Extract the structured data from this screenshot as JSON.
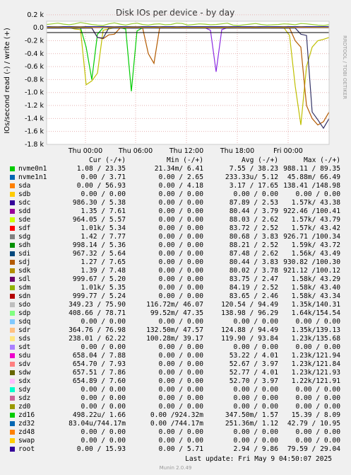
{
  "chart_data": {
    "type": "line",
    "title": "Disk IOs per device - by day",
    "ylabel": "IOs/second read (-) / write (+)",
    "ylim": [
      -1800,
      100
    ],
    "y_ticks": [
      "0.2 k",
      "0.0",
      "-0.2 k",
      "-0.4 k",
      "-0.6 k",
      "-0.8 k",
      "-1.0 k",
      "-1.2 k",
      "-1.4 k",
      "-1.6 k",
      "-1.8 k"
    ],
    "x_ticks": [
      "Thu 00:00",
      "Thu 06:00",
      "Thu 12:00",
      "Thu 18:00",
      "Fri 00:00"
    ],
    "grid": true,
    "series_read": [
      {
        "name": "sdm",
        "color": "#bfbf00",
        "values": [
          0,
          0,
          0,
          0,
          0,
          -20,
          -30,
          -880,
          -820,
          -700,
          -40,
          -20,
          0,
          0,
          0,
          0,
          0,
          0,
          0,
          0,
          0,
          0,
          0,
          0,
          0,
          0,
          0,
          0,
          0,
          0,
          0,
          0,
          0,
          0,
          0,
          0,
          0,
          0,
          0,
          0,
          0,
          0,
          0,
          -120,
          -900,
          -1500,
          -600,
          -300,
          -200,
          -180,
          -150
        ]
      },
      {
        "name": "zd16",
        "color": "#00cc00",
        "values": [
          0,
          0,
          0,
          0,
          0,
          0,
          0,
          -300,
          -800,
          -100,
          0,
          0,
          0,
          0,
          -20,
          -980,
          -50,
          0,
          0,
          0,
          0,
          0,
          0,
          0,
          0,
          0,
          0,
          0,
          0,
          0,
          0,
          0,
          0,
          0,
          0,
          0,
          0,
          0,
          0,
          0,
          0,
          0,
          0,
          0,
          0,
          0,
          0,
          0,
          0,
          0,
          0
        ]
      },
      {
        "name": "sdc",
        "color": "#8a2be2",
        "values": [
          0,
          0,
          0,
          0,
          0,
          0,
          0,
          0,
          0,
          0,
          0,
          0,
          0,
          0,
          0,
          0,
          0,
          0,
          0,
          0,
          0,
          0,
          0,
          0,
          0,
          0,
          0,
          0,
          0,
          -40,
          -680,
          -30,
          0,
          0,
          0,
          0,
          0,
          0,
          0,
          0,
          0,
          0,
          0,
          0,
          0,
          0,
          0,
          0,
          0,
          0,
          0
        ]
      },
      {
        "name": "sdj",
        "color": "#b35a00",
        "values": [
          -5,
          -5,
          -5,
          -5,
          -5,
          -5,
          -5,
          -5,
          -5,
          -150,
          -170,
          -110,
          -100,
          -5,
          -5,
          -5,
          -5,
          -5,
          -400,
          -550,
          -5,
          -5,
          -5,
          -5,
          -5,
          -5,
          -5,
          -5,
          -5,
          -5,
          -5,
          -5,
          -5,
          -5,
          -5,
          -5,
          -5,
          -5,
          -5,
          -5,
          -5,
          -5,
          -5,
          -5,
          -200,
          -300,
          -1200,
          -1400,
          -1500,
          -1450,
          -1300
        ]
      },
      {
        "name": "sdi",
        "color": "#333366",
        "values": [
          -5,
          -5,
          -5,
          -5,
          -5,
          -5,
          -5,
          -5,
          -5,
          -150,
          -160,
          -5,
          -5,
          -5,
          -5,
          -5,
          -5,
          -5,
          -5,
          -5,
          -5,
          -5,
          -5,
          -5,
          -5,
          -5,
          -5,
          -5,
          -5,
          -5,
          -5,
          -5,
          -5,
          -5,
          -5,
          -5,
          -5,
          -5,
          -5,
          -5,
          -5,
          -5,
          -5,
          -5,
          -5,
          -100,
          -120,
          -1300,
          -1420,
          -1550,
          -1400
        ]
      }
    ],
    "series_write": [
      {
        "name": "sdl",
        "color": "#9acd32",
        "values": [
          50,
          60,
          70,
          55,
          45,
          60,
          80,
          65,
          50,
          40,
          35,
          60,
          75,
          55,
          40,
          60,
          70,
          50,
          40,
          55,
          60,
          45,
          50,
          70,
          65,
          40,
          50,
          60,
          55,
          45,
          50,
          60,
          70,
          40,
          35,
          45,
          55,
          65,
          50,
          40,
          45,
          50,
          60,
          55,
          45,
          65,
          60,
          50,
          40,
          35,
          45
        ]
      },
      {
        "name": "root",
        "color": "#000099",
        "values": [
          16,
          16,
          16,
          16,
          16,
          16,
          16,
          16,
          16,
          16,
          16,
          16,
          16,
          16,
          16,
          16,
          16,
          16,
          16,
          16,
          16,
          16,
          16,
          16,
          16,
          16,
          16,
          16,
          16,
          16,
          16,
          16,
          16,
          16,
          16,
          16,
          16,
          16,
          16,
          16,
          16,
          16,
          16,
          16,
          16,
          16,
          16,
          16,
          16,
          16,
          16
        ]
      },
      {
        "name": "zd48",
        "color": "#cc9900",
        "values": [
          5,
          8,
          10,
          6,
          5,
          8,
          12,
          6,
          5,
          4,
          4,
          6,
          10,
          6,
          5,
          8,
          10,
          6,
          5,
          6,
          8,
          5,
          5,
          8,
          6,
          5,
          5,
          6,
          6,
          5,
          5,
          6,
          8,
          5,
          4,
          5,
          6,
          8,
          5,
          4,
          5,
          6,
          8,
          6,
          5,
          8,
          6,
          5,
          4,
          4,
          5
        ]
      }
    ]
  },
  "legend": {
    "headers": {
      "cur": "Cur (-/+)",
      "min": "Min (-/+)",
      "avg": "Avg (-/+)",
      "max": "Max (-/+)"
    },
    "rows": [
      {
        "name": "nvme0n1",
        "color": "#00cc00",
        "cur": "1.08 / 23.35",
        "min": "21.34m/ 6.41",
        "avg": "7.55 / 38.23",
        "max": "988.11 / 89.35"
      },
      {
        "name": "nvme1n1",
        "color": "#0066b3",
        "cur": "0.00 / 3.71",
        "min": "0.00 / 2.65",
        "avg": "233.33u/ 5.12",
        "max": "45.88m/ 66.49"
      },
      {
        "name": "sda",
        "color": "#ff8000",
        "cur": "0.00 / 56.93",
        "min": "0.00 / 4.18",
        "avg": "3.17 / 17.65",
        "max": "138.41 /148.98"
      },
      {
        "name": "sdb",
        "color": "#ffcc00",
        "cur": "0.00 / 0.00",
        "min": "0.00 / 0.00",
        "avg": "0.00 / 0.00",
        "max": "0.00 / 0.00"
      },
      {
        "name": "sdc",
        "color": "#330099",
        "cur": "986.30 / 5.38",
        "min": "0.00 / 0.00",
        "avg": "87.89 / 2.53",
        "max": "1.57k/ 43.38"
      },
      {
        "name": "sdd",
        "color": "#990099",
        "cur": "1.35 / 7.61",
        "min": "0.00 / 0.00",
        "avg": "80.44 / 3.79",
        "max": "922.46 /100.41"
      },
      {
        "name": "sde",
        "color": "#ccff00",
        "cur": "964.05 / 5.57",
        "min": "0.00 / 0.00",
        "avg": "88.03 / 2.62",
        "max": "1.57k/ 43.79"
      },
      {
        "name": "sdf",
        "color": "#ff0000",
        "cur": "1.01k/ 5.34",
        "min": "0.00 / 0.00",
        "avg": "83.72 / 2.52",
        "max": "1.57k/ 43.42"
      },
      {
        "name": "sdg",
        "color": "#808080",
        "cur": "1.42 / 7.77",
        "min": "0.00 / 0.00",
        "avg": "80.68 / 3.83",
        "max": "926.71 /100.34"
      },
      {
        "name": "sdh",
        "color": "#008f00",
        "cur": "998.14 / 5.36",
        "min": "0.00 / 0.00",
        "avg": "88.21 / 2.52",
        "max": "1.59k/ 43.72"
      },
      {
        "name": "sdi",
        "color": "#00487d",
        "cur": "967.32 / 5.64",
        "min": "0.00 / 0.00",
        "avg": "87.48 / 2.62",
        "max": "1.56k/ 43.49"
      },
      {
        "name": "sdj",
        "color": "#b35a00",
        "cur": "1.27 / 7.65",
        "min": "0.00 / 0.00",
        "avg": "80.44 / 3.83",
        "max": "930.82 /100.30"
      },
      {
        "name": "sdk",
        "color": "#b38f00",
        "cur": "1.39 / 7.48",
        "min": "0.00 / 0.00",
        "avg": "80.02 / 3.78",
        "max": "921.12 /100.12"
      },
      {
        "name": "sdl",
        "color": "#6b006b",
        "cur": "999.67 / 5.20",
        "min": "0.00 / 0.00",
        "avg": "83.75 / 2.47",
        "max": "1.58k/ 43.29"
      },
      {
        "name": "sdm",
        "color": "#8fb300",
        "cur": "1.01k/ 5.35",
        "min": "0.00 / 0.00",
        "avg": "84.19 / 2.52",
        "max": "1.58k/ 43.40"
      },
      {
        "name": "sdn",
        "color": "#b30000",
        "cur": "999.77 / 5.24",
        "min": "0.00 / 0.00",
        "avg": "83.65 / 2.46",
        "max": "1.58k/ 43.34"
      },
      {
        "name": "sdo",
        "color": "#bebebe",
        "cur": "349.23 / 75.90",
        "min": "116.72m/ 46.07",
        "avg": "120.54 / 94.49",
        "max": "1.35k/140.31"
      },
      {
        "name": "sdp",
        "color": "#80ff80",
        "cur": "408.66 / 78.71",
        "min": "99.52m/ 47.35",
        "avg": "138.98 / 96.29",
        "max": "1.64k/154.54"
      },
      {
        "name": "sdq",
        "color": "#80c9ff",
        "cur": "0.00 / 0.00",
        "min": "0.00 / 0.00",
        "avg": "0.00 / 0.00",
        "max": "0.00 / 0.00"
      },
      {
        "name": "sdr",
        "color": "#ffc080",
        "cur": "364.76 / 76.98",
        "min": "132.50m/ 47.57",
        "avg": "124.88 / 94.49",
        "max": "1.35k/139.13"
      },
      {
        "name": "sds",
        "color": "#ffe680",
        "cur": "238.01 / 62.22",
        "min": "100.28m/ 39.17",
        "avg": "119.90 / 93.84",
        "max": "1.23k/135.68"
      },
      {
        "name": "sdt",
        "color": "#aa80ff",
        "cur": "0.00 / 0.00",
        "min": "0.00 / 0.00",
        "avg": "0.00 / 0.00",
        "max": "0.00 / 0.00"
      },
      {
        "name": "sdu",
        "color": "#ee00cc",
        "cur": "658.04 / 7.88",
        "min": "0.00 / 0.00",
        "avg": "53.22 / 4.01",
        "max": "1.23k/121.94"
      },
      {
        "name": "sdv",
        "color": "#ff8080",
        "cur": "654.70 / 7.93",
        "min": "0.00 / 0.00",
        "avg": "52.67 / 3.97",
        "max": "1.23k/121.84"
      },
      {
        "name": "sdw",
        "color": "#666600",
        "cur": "657.51 / 7.86",
        "min": "0.00 / 0.00",
        "avg": "52.77 / 4.01",
        "max": "1.23k/121.93"
      },
      {
        "name": "sdx",
        "color": "#ffbfff",
        "cur": "654.89 / 7.60",
        "min": "0.00 / 0.00",
        "avg": "52.70 / 3.97",
        "max": "1.22k/121.91"
      },
      {
        "name": "sdy",
        "color": "#00ffcc",
        "cur": "0.00 / 0.00",
        "min": "0.00 / 0.00",
        "avg": "0.00 / 0.00",
        "max": "0.00 / 0.00"
      },
      {
        "name": "sdz",
        "color": "#cc6699",
        "cur": "0.00 / 0.00",
        "min": "0.00 / 0.00",
        "avg": "0.00 / 0.00",
        "max": "0.00 / 0.00"
      },
      {
        "name": "zd0",
        "color": "#999900",
        "cur": "0.00 / 0.00",
        "min": "0.00 / 0.00",
        "avg": "0.00 / 0.00",
        "max": "0.00 / 0.00"
      },
      {
        "name": "zd16",
        "color": "#00cc00",
        "cur": "498.22u/ 1.66",
        "min": "0.00 /924.32m",
        "avg": "347.50m/ 1.57",
        "max": "15.39 / 8.09"
      },
      {
        "name": "zd32",
        "color": "#0066b3",
        "cur": "83.04u/744.17m",
        "min": "0.00 /744.17m",
        "avg": "251.36m/ 1.12",
        "max": "42.79 / 10.95"
      },
      {
        "name": "zd48",
        "color": "#ff8000",
        "cur": "0.00 / 0.00",
        "min": "0.00 / 0.00",
        "avg": "0.00 / 0.00",
        "max": "0.00 / 0.00"
      },
      {
        "name": "swap",
        "color": "#ffcc00",
        "cur": "0.00 / 0.00",
        "min": "0.00 / 0.00",
        "avg": "0.00 / 0.00",
        "max": "0.00 / 0.00"
      },
      {
        "name": "root",
        "color": "#330099",
        "cur": "0.00 / 15.93",
        "min": "0.00 / 5.71",
        "avg": "2.94 / 9.86",
        "max": "79.59 / 29.04"
      }
    ]
  },
  "footer": {
    "last_update": "Last update: Fri May  9 04:50:07 2025",
    "version": "Munin 2.0.49"
  },
  "side_label": "RRDTOOL / TOBI OETIKER"
}
